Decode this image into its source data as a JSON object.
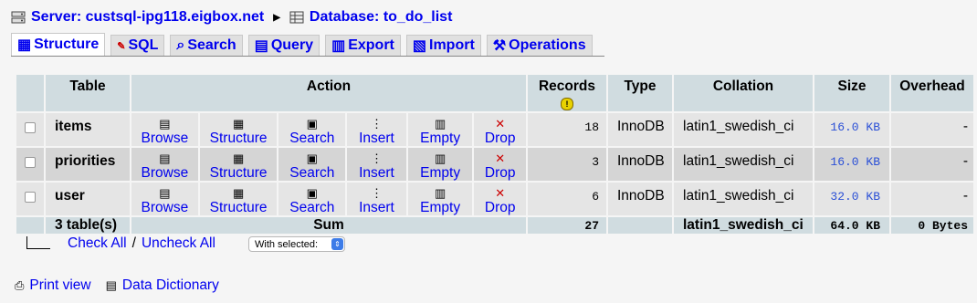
{
  "breadcrumb": {
    "server_label": "Server: custsql-ipg118.eigbox.net",
    "database_label": "Database: to_do_list"
  },
  "tabs": [
    {
      "label": "Structure",
      "icon": "structure-icon"
    },
    {
      "label": "SQL",
      "icon": "sql-icon"
    },
    {
      "label": "Search",
      "icon": "search-icon"
    },
    {
      "label": "Query",
      "icon": "query-icon"
    },
    {
      "label": "Export",
      "icon": "export-icon"
    },
    {
      "label": "Import",
      "icon": "import-icon"
    },
    {
      "label": "Operations",
      "icon": "operations-icon"
    }
  ],
  "table": {
    "headers": {
      "table": "Table",
      "action": "Action",
      "records": "Records",
      "type": "Type",
      "collation": "Collation",
      "size": "Size",
      "overhead": "Overhead"
    },
    "actions": [
      "Browse",
      "Structure",
      "Search",
      "Insert",
      "Empty",
      "Drop"
    ],
    "rows": [
      {
        "name": "items",
        "records": "18",
        "type": "InnoDB",
        "collation": "latin1_swedish_ci",
        "size": "16.0 KB",
        "overhead": "-"
      },
      {
        "name": "priorities",
        "records": "3",
        "type": "InnoDB",
        "collation": "latin1_swedish_ci",
        "size": "16.0 KB",
        "overhead": "-"
      },
      {
        "name": "user",
        "records": "6",
        "type": "InnoDB",
        "collation": "latin1_swedish_ci",
        "size": "32.0 KB",
        "overhead": "-"
      }
    ],
    "footer": {
      "count": "3 table(s)",
      "sum_label": "Sum",
      "records": "27",
      "collation": "latin1_swedish_ci",
      "size": "64.0 KB",
      "overhead": "0 Bytes"
    }
  },
  "bulk": {
    "check_all": "Check All",
    "separator": "/",
    "uncheck_all": "Uncheck All",
    "with_selected": "With selected:"
  },
  "footer_links": {
    "print_view": "Print view",
    "data_dictionary": "Data Dictionary"
  }
}
